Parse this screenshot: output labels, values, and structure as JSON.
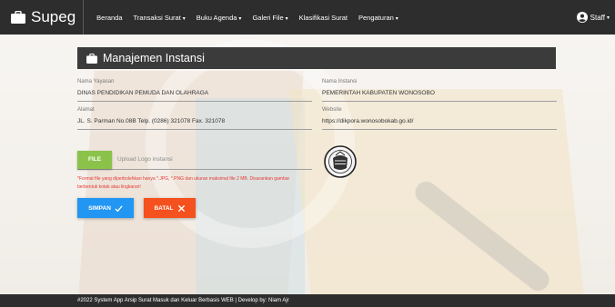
{
  "navbar": {
    "brand": "Supeg",
    "items": [
      {
        "label": "Beranda",
        "dropdown": false
      },
      {
        "label": "Transaksi Surat",
        "dropdown": true
      },
      {
        "label": "Buku Agenda",
        "dropdown": true
      },
      {
        "label": "Galeri File",
        "dropdown": true
      },
      {
        "label": "Klasifikasi Surat",
        "dropdown": false
      },
      {
        "label": "Pengaturan",
        "dropdown": true
      }
    ],
    "user": "Staff",
    "caret": "▾"
  },
  "card": {
    "title": "Manajemen Instansi",
    "fields": {
      "nama_yayasan": {
        "label": "Nama Yayasan",
        "value": "DINAS PENDIDIKAN PEMUDA DAN OLAHRAGA"
      },
      "nama_instansi": {
        "label": "Nama Instansi",
        "value": "PEMERINTAH KABUPATEN WONOSOBO"
      },
      "alamat": {
        "label": "Alamat",
        "value": "JL. S. Parman No.08B Telp. (0286) 321078 Fax. 321078"
      },
      "website": {
        "label": "Website",
        "value": "https://dikpora.wonosobokab.go.id/"
      }
    },
    "file_button": "FILE",
    "file_placeholder": "Upload Logo instansi",
    "note": "*Format file yang diperbolehkan hanya *.JPG, *.PNG dan ukuran maksimal file 2 MB. Disarankan gambar berbentuk kotak atau lingkaran!",
    "save_button": "SIMPAN",
    "cancel_button": "BATAL"
  },
  "footer": {
    "text": "#2022 System App Arsip Surat Masuk dan Keluar Berbasis WEB | Develop by: Niam Ajr"
  },
  "colors": {
    "navbar": "#2d2d2d",
    "file_button": "#8bc34a",
    "save_button": "#2196f3",
    "cancel_button": "#f4511e",
    "note": "#e53935"
  },
  "icons": [
    "briefcase-icon",
    "user-circle-icon",
    "check-icon",
    "close-icon"
  ]
}
